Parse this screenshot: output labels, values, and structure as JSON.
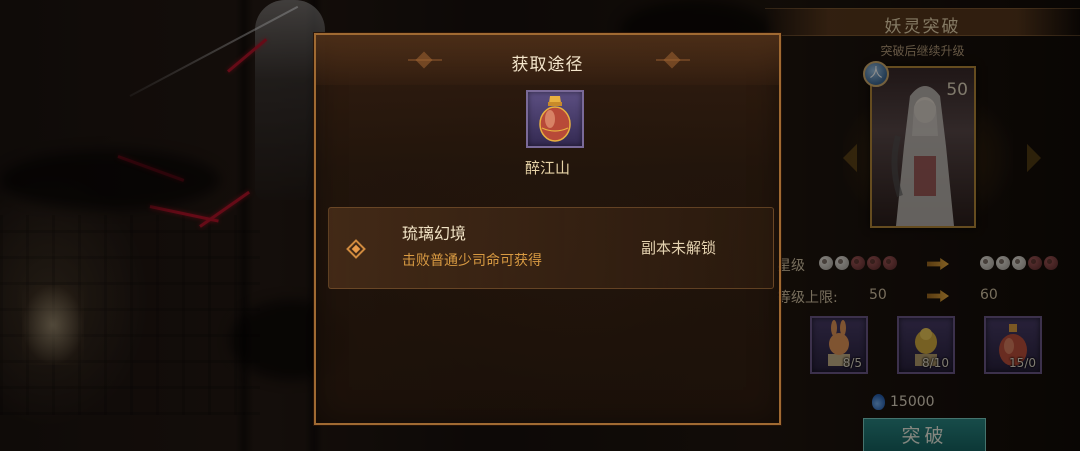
{
  "modal": {
    "title": "获取途径",
    "item": {
      "name": "醉江山",
      "icon": "potion-flask-icon"
    },
    "sources": [
      {
        "name": "琉璃幻境",
        "description": "击败普通少司命可获得",
        "status": "副本未解锁"
      }
    ]
  },
  "breakthrough_panel": {
    "title": "妖灵突破",
    "subtitle": "突破后继续升级",
    "card": {
      "level": "50",
      "type_badge": "人"
    },
    "star_label": "星级",
    "star_before": {
      "filled": 2,
      "total": 5
    },
    "star_after": {
      "filled": 3,
      "total": 5
    },
    "level_cap_label": "等级上限:",
    "level_cap_before": "50",
    "level_cap_after": "60",
    "materials": [
      {
        "icon": "rabbit-statue-icon",
        "count": "8/5"
      },
      {
        "icon": "golden-lion-statue-icon",
        "count": "8/10"
      },
      {
        "icon": "potion-flask-icon",
        "count": "15/0"
      }
    ],
    "cost_icon": "spirit-jade-icon",
    "cost": "15000",
    "button_label": "突破"
  },
  "colors": {
    "modal_border": "#a06a32",
    "source_desc": "#d89a42",
    "button": "#1e7672"
  }
}
